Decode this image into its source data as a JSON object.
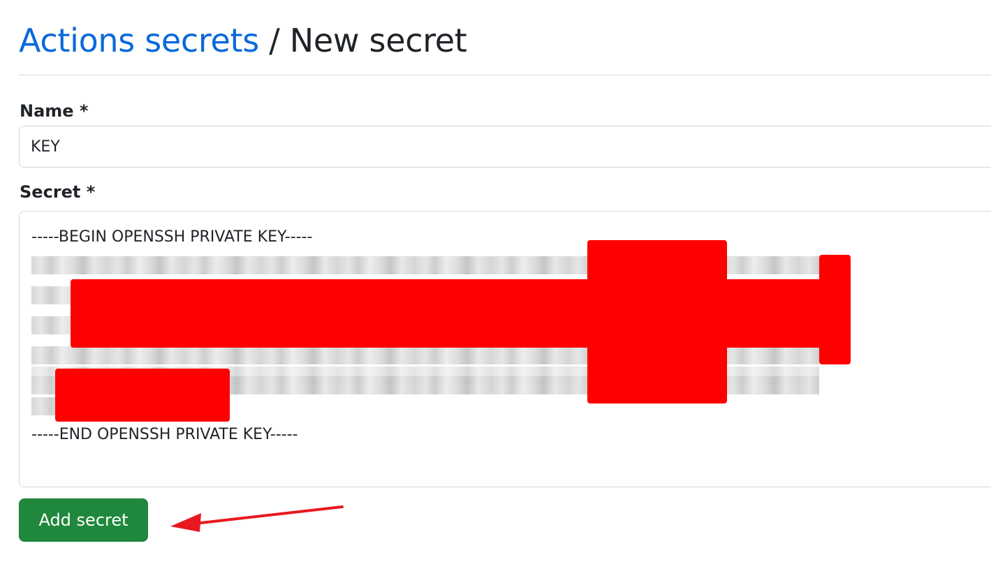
{
  "header": {
    "breadcrumb_link": "Actions secrets",
    "separator": "/",
    "current_page": "New secret"
  },
  "form": {
    "name_label": "Name *",
    "name_value": "KEY",
    "secret_label": "Secret *",
    "secret_first_line": "-----BEGIN OPENSSH PRIVATE KEY-----",
    "secret_last_line": "-----END OPENSSH PRIVATE KEY-----",
    "submit_label": "Add secret"
  },
  "colors": {
    "link": "#0969da",
    "button_bg": "#1f883d",
    "redaction": "#ff0000",
    "annotation_arrow": "#e8191e"
  },
  "icons": {
    "annotation": "arrow-left-icon"
  }
}
